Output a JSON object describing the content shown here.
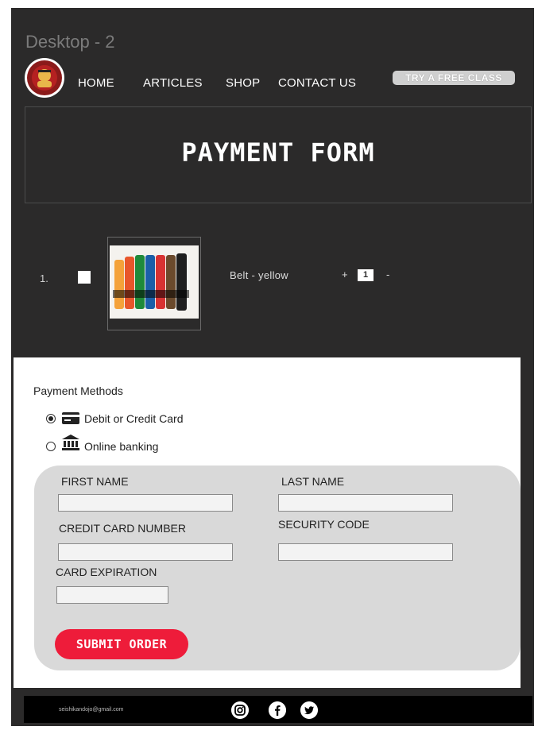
{
  "frame_title": "Desktop - 2",
  "nav": [
    "HOME",
    "ARTICLES",
    "SHOP",
    "CONTACT US"
  ],
  "cta": "TRY A FREE CLASS",
  "banner_title": "PAYMENT FORM",
  "cart_item": {
    "number": "1.",
    "name": "Belt  -  yellow",
    "plus": "+",
    "quantity": "1",
    "minus": "-"
  },
  "payment": {
    "title": "Payment Methods",
    "options": [
      {
        "label": "Debit or Credit Card",
        "selected": true,
        "icon": "credit-card-icon"
      },
      {
        "label": "Online banking",
        "selected": false,
        "icon": "bank-icon"
      }
    ]
  },
  "form": {
    "first_name": "FIRST NAME",
    "last_name": "LAST NAME",
    "card_number": "CREDIT CARD NUMBER",
    "security_code": "SECURITY CODE",
    "card_expiration": "CARD EXPIRATION",
    "submit": "SUBMIT ORDER"
  },
  "footer": {
    "email": "seishikandojo@gmail.com",
    "social_icons": [
      "instagram-icon",
      "facebook-icon",
      "twitter-icon"
    ]
  },
  "colors": {
    "background": "#2b2a2a",
    "accent": "#ee1c3a",
    "form_card": "#d9d9d9"
  }
}
